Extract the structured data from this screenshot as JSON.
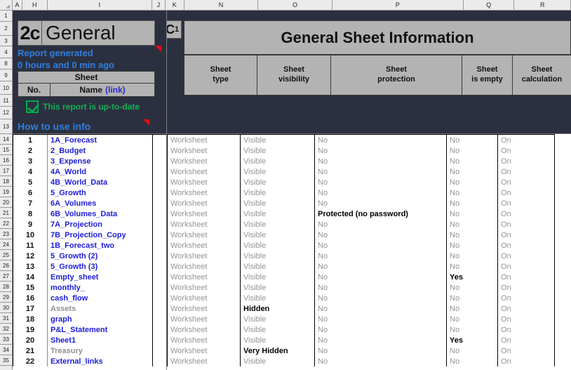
{
  "app": {
    "background_color": "#2b3040",
    "banner_color": "#b3b3b3",
    "link_color": "#1d1dd6",
    "accent_blue": "#2f7fe0",
    "accent_green": "#12b152",
    "muted_gray": "#949494"
  },
  "column_headers": [
    "A",
    "H",
    "I",
    "J",
    "K",
    "N",
    "O",
    "P",
    "Q",
    "R"
  ],
  "row_headers": [
    "1",
    "2",
    "3",
    "4",
    "8",
    "9",
    "10",
    "11",
    "12",
    "13",
    "14",
    "15",
    "16",
    "17",
    "18",
    "19",
    "20",
    "21",
    "22",
    "23",
    "24",
    "25",
    "26",
    "27",
    "28",
    "29",
    "30",
    "31",
    "32",
    "33",
    "34",
    "35"
  ],
  "logo": {
    "number": "2c",
    "name": "General"
  },
  "report_status": {
    "line1": "Report generated",
    "line2": "0 hours and 0 min ago",
    "uptodate_label": "This report is up-to-date",
    "checkbox_checked": "checked"
  },
  "sheet_table_header": {
    "group": "Sheet",
    "no": "No.",
    "name": "Name",
    "name_link": "(link)"
  },
  "how_to_use": {
    "label": "How to use info"
  },
  "right_panel": {
    "cell_ref": "C",
    "cell_ref_sub": "1",
    "title": "General Sheet Information",
    "headers": [
      {
        "line1": "Sheet",
        "line2": "type"
      },
      {
        "line1": "Sheet",
        "line2": "visibility"
      },
      {
        "line1": "Sheet",
        "line2": "protection"
      },
      {
        "line1": "Sheet",
        "line2": "is empty"
      },
      {
        "line1": "Sheet",
        "line2": "calculation"
      }
    ]
  },
  "rows": [
    {
      "no": "1",
      "name": "1A_Forecast",
      "name_muted": false,
      "type": "Worksheet",
      "visibility": "Visible",
      "visibility_bold": false,
      "protection": "No",
      "protection_bold": false,
      "is_empty": "No",
      "is_empty_bold": false,
      "calculation": "On"
    },
    {
      "no": "2",
      "name": "2_Budget",
      "name_muted": false,
      "type": "Worksheet",
      "visibility": "Visible",
      "visibility_bold": false,
      "protection": "No",
      "protection_bold": false,
      "is_empty": "No",
      "is_empty_bold": false,
      "calculation": "On"
    },
    {
      "no": "3",
      "name": "3_Expense",
      "name_muted": false,
      "type": "Worksheet",
      "visibility": "Visible",
      "visibility_bold": false,
      "protection": "No",
      "protection_bold": false,
      "is_empty": "No",
      "is_empty_bold": false,
      "calculation": "On"
    },
    {
      "no": "4",
      "name": "4A_World",
      "name_muted": false,
      "type": "Worksheet",
      "visibility": "Visible",
      "visibility_bold": false,
      "protection": "No",
      "protection_bold": false,
      "is_empty": "No",
      "is_empty_bold": false,
      "calculation": "On"
    },
    {
      "no": "5",
      "name": "4B_World_Data",
      "name_muted": false,
      "type": "Worksheet",
      "visibility": "Visible",
      "visibility_bold": false,
      "protection": "No",
      "protection_bold": false,
      "is_empty": "No",
      "is_empty_bold": false,
      "calculation": "On"
    },
    {
      "no": "6",
      "name": "5_Growth",
      "name_muted": false,
      "type": "Worksheet",
      "visibility": "Visible",
      "visibility_bold": false,
      "protection": "No",
      "protection_bold": false,
      "is_empty": "No",
      "is_empty_bold": false,
      "calculation": "On"
    },
    {
      "no": "7",
      "name": "6A_Volumes",
      "name_muted": false,
      "type": "Worksheet",
      "visibility": "Visible",
      "visibility_bold": false,
      "protection": "No",
      "protection_bold": false,
      "is_empty": "No",
      "is_empty_bold": false,
      "calculation": "On"
    },
    {
      "no": "8",
      "name": "6B_Volumes_Data",
      "name_muted": false,
      "type": "Worksheet",
      "visibility": "Visible",
      "visibility_bold": false,
      "protection": "Protected (no password)",
      "protection_bold": true,
      "is_empty": "No",
      "is_empty_bold": false,
      "calculation": "On"
    },
    {
      "no": "9",
      "name": "7A_Projection",
      "name_muted": false,
      "type": "Worksheet",
      "visibility": "Visible",
      "visibility_bold": false,
      "protection": "No",
      "protection_bold": false,
      "is_empty": "No",
      "is_empty_bold": false,
      "calculation": "On"
    },
    {
      "no": "10",
      "name": "7B_Projection_Copy",
      "name_muted": false,
      "type": "Worksheet",
      "visibility": "Visible",
      "visibility_bold": false,
      "protection": "No",
      "protection_bold": false,
      "is_empty": "No",
      "is_empty_bold": false,
      "calculation": "On"
    },
    {
      "no": "11",
      "name": "1B_Forecast_two",
      "name_muted": false,
      "type": "Worksheet",
      "visibility": "Visible",
      "visibility_bold": false,
      "protection": "No",
      "protection_bold": false,
      "is_empty": "No",
      "is_empty_bold": false,
      "calculation": "On"
    },
    {
      "no": "12",
      "name": "5_Growth (2)",
      "name_muted": false,
      "type": "Worksheet",
      "visibility": "Visible",
      "visibility_bold": false,
      "protection": "No",
      "protection_bold": false,
      "is_empty": "No",
      "is_empty_bold": false,
      "calculation": "On"
    },
    {
      "no": "13",
      "name": "5_Growth (3)",
      "name_muted": false,
      "type": "Worksheet",
      "visibility": "Visible",
      "visibility_bold": false,
      "protection": "No",
      "protection_bold": false,
      "is_empty": "No",
      "is_empty_bold": false,
      "calculation": "On"
    },
    {
      "no": "14",
      "name": "Empty_sheet",
      "name_muted": false,
      "type": "Worksheet",
      "visibility": "Visible",
      "visibility_bold": false,
      "protection": "No",
      "protection_bold": false,
      "is_empty": "Yes",
      "is_empty_bold": true,
      "calculation": "On"
    },
    {
      "no": "15",
      "name": "monthly_",
      "name_muted": false,
      "type": "Worksheet",
      "visibility": "Visible",
      "visibility_bold": false,
      "protection": "No",
      "protection_bold": false,
      "is_empty": "No",
      "is_empty_bold": false,
      "calculation": "On"
    },
    {
      "no": "16",
      "name": "cash_flow",
      "name_muted": false,
      "type": "Worksheet",
      "visibility": "Visible",
      "visibility_bold": false,
      "protection": "No",
      "protection_bold": false,
      "is_empty": "No",
      "is_empty_bold": false,
      "calculation": "On"
    },
    {
      "no": "17",
      "name": "Assets",
      "name_muted": true,
      "type": "Worksheet",
      "visibility": "Hidden",
      "visibility_bold": true,
      "protection": "No",
      "protection_bold": false,
      "is_empty": "No",
      "is_empty_bold": false,
      "calculation": "On"
    },
    {
      "no": "18",
      "name": "graph",
      "name_muted": false,
      "type": "Worksheet",
      "visibility": "Visible",
      "visibility_bold": false,
      "protection": "No",
      "protection_bold": false,
      "is_empty": "No",
      "is_empty_bold": false,
      "calculation": "On"
    },
    {
      "no": "19",
      "name": "P&L_Statement",
      "name_muted": false,
      "type": "Worksheet",
      "visibility": "Visible",
      "visibility_bold": false,
      "protection": "No",
      "protection_bold": false,
      "is_empty": "No",
      "is_empty_bold": false,
      "calculation": "On"
    },
    {
      "no": "20",
      "name": "Sheet1",
      "name_muted": false,
      "type": "Worksheet",
      "visibility": "Visible",
      "visibility_bold": false,
      "protection": "No",
      "protection_bold": false,
      "is_empty": "Yes",
      "is_empty_bold": true,
      "calculation": "On"
    },
    {
      "no": "21",
      "name": "Treasury",
      "name_muted": true,
      "type": "Worksheet",
      "visibility": "Very Hidden",
      "visibility_bold": true,
      "protection": "No",
      "protection_bold": false,
      "is_empty": "No",
      "is_empty_bold": false,
      "calculation": "On"
    },
    {
      "no": "22",
      "name": "External_links",
      "name_muted": false,
      "type": "Worksheet",
      "visibility": "Visible",
      "visibility_bold": false,
      "protection": "No",
      "protection_bold": false,
      "is_empty": "No",
      "is_empty_bold": false,
      "calculation": "On"
    }
  ]
}
